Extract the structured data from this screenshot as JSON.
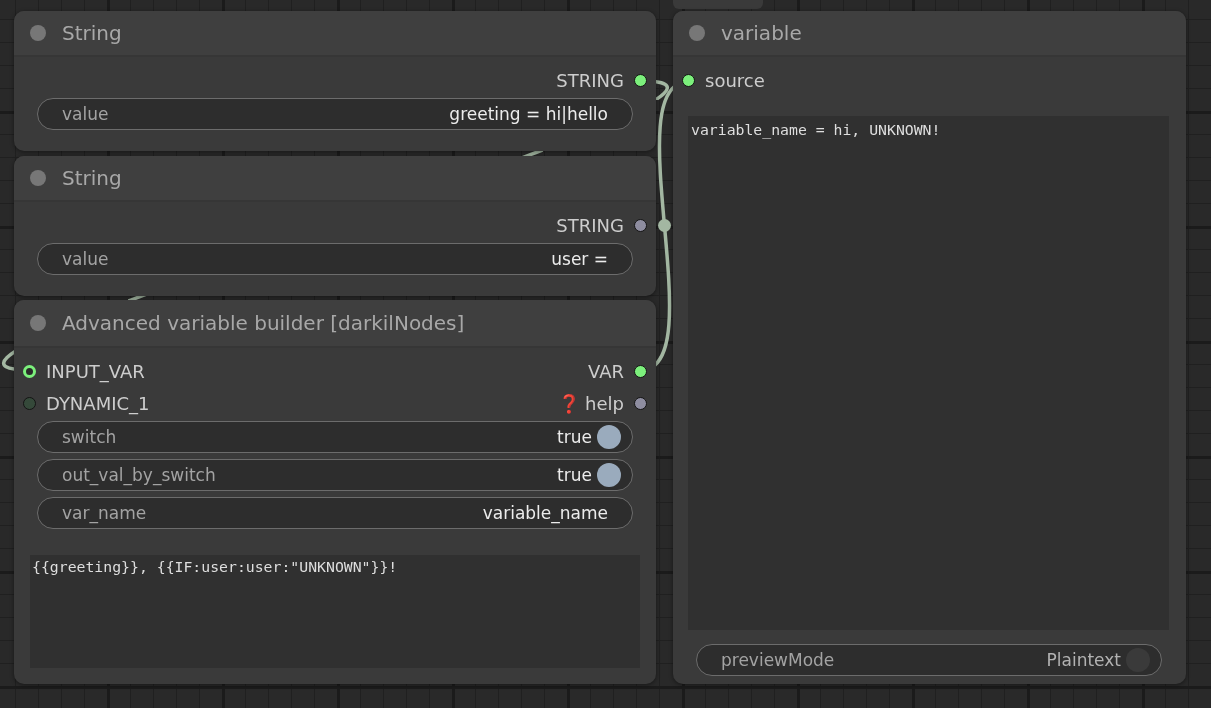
{
  "nodes": [
    {
      "title": "String",
      "outputs": [
        {
          "label": "STRING",
          "kind": "dot",
          "color": "#7cf07c"
        }
      ],
      "widgets": [
        {
          "kind": "text",
          "label": "value",
          "value": "greeting = hi|hello"
        }
      ]
    },
    {
      "title": "String",
      "outputs": [
        {
          "label": "STRING",
          "kind": "dot",
          "color": "#8e8da0"
        }
      ],
      "widgets": [
        {
          "kind": "text",
          "label": "value",
          "value": "user ="
        }
      ]
    },
    {
      "title": "Advanced variable builder [darkilNodes]",
      "inputs": [
        {
          "label": "INPUT_VAR",
          "kind": "ring",
          "color": "#7cf07c"
        },
        {
          "label": "DYNAMIC_1",
          "kind": "dot",
          "color": "#35493a"
        }
      ],
      "outputs": [
        {
          "label": "VAR",
          "kind": "dot",
          "color": "#7cf07c"
        },
        {
          "label": "help",
          "glyph": "❓",
          "kind": "dot",
          "color": "#8e8da0"
        }
      ],
      "widgets": [
        {
          "kind": "toggle",
          "label": "switch",
          "value": "true",
          "on": true
        },
        {
          "kind": "toggle",
          "label": "out_val_by_switch",
          "value": "true",
          "on": true
        },
        {
          "kind": "text",
          "label": "var_name",
          "value": "variable_name"
        },
        {
          "kind": "textarea",
          "value": "{{greeting}}, {{IF:user:user:\"UNKNOWN\"}}!"
        }
      ]
    },
    {
      "title": "variable",
      "inputs": [
        {
          "label": "source",
          "kind": "dot",
          "color": "#7cf07c"
        }
      ],
      "widgets": [
        {
          "kind": "textarea",
          "value": "variable_name = hi, UNKNOWN!"
        },
        {
          "kind": "toggle",
          "label": "previewMode",
          "value": "Plaintext",
          "on": false
        }
      ]
    }
  ]
}
